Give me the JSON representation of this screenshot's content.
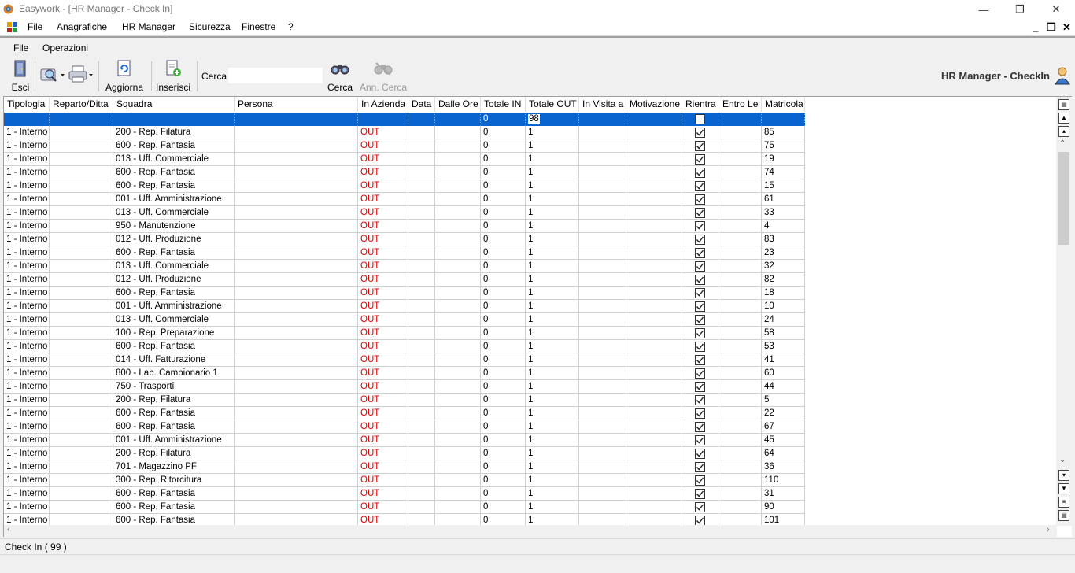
{
  "window": {
    "title": "Easywork - [HR Manager - Check In]"
  },
  "menubar": {
    "items": [
      "File",
      "Anagrafiche",
      "HR Manager",
      "Sicurezza",
      "Finestre",
      "?"
    ]
  },
  "childmenu": {
    "items": [
      "File",
      "Operazioni"
    ]
  },
  "toolbar": {
    "esci": "Esci",
    "aggiorna": "Aggiorna",
    "inserisci": "Inserisci",
    "cerca_label": "Cerca",
    "cerca_value": "",
    "cerca_button": "Cerca",
    "ann_cerca": "Ann. Cerca",
    "module_title": "HR Manager - CheckIn"
  },
  "grid": {
    "columns": [
      "Tipologia",
      "Reparto/Ditta",
      "Squadra",
      "Persona",
      "In Azienda",
      "Data",
      "Dalle Ore",
      "Totale IN",
      "Totale OUT",
      "In Visita a",
      "Motivazione",
      "Rientra",
      "Entro Le",
      "Matricola"
    ],
    "summary_row": {
      "totale_in": "0",
      "totale_out": "98",
      "rientra": false
    },
    "rows": [
      {
        "tipologia": "1 - Interno",
        "squadra": "200 - Rep. Filatura",
        "in_azienda": "OUT",
        "totale_in": "0",
        "totale_out": "1",
        "rientra": true,
        "matricola": "85"
      },
      {
        "tipologia": "1 - Interno",
        "squadra": "600 - Rep. Fantasia",
        "in_azienda": "OUT",
        "totale_in": "0",
        "totale_out": "1",
        "rientra": true,
        "matricola": "75"
      },
      {
        "tipologia": "1 - Interno",
        "squadra": "013 - Uff. Commerciale",
        "in_azienda": "OUT",
        "totale_in": "0",
        "totale_out": "1",
        "rientra": true,
        "matricola": "19"
      },
      {
        "tipologia": "1 - Interno",
        "squadra": "600 - Rep. Fantasia",
        "in_azienda": "OUT",
        "totale_in": "0",
        "totale_out": "1",
        "rientra": true,
        "matricola": "74"
      },
      {
        "tipologia": "1 - Interno",
        "squadra": "600 - Rep. Fantasia",
        "in_azienda": "OUT",
        "totale_in": "0",
        "totale_out": "1",
        "rientra": true,
        "matricola": "15"
      },
      {
        "tipologia": "1 - Interno",
        "squadra": "001 - Uff. Amministrazione",
        "in_azienda": "OUT",
        "totale_in": "0",
        "totale_out": "1",
        "rientra": true,
        "matricola": "61"
      },
      {
        "tipologia": "1 - Interno",
        "squadra": "013 - Uff. Commerciale",
        "in_azienda": "OUT",
        "totale_in": "0",
        "totale_out": "1",
        "rientra": true,
        "matricola": "33"
      },
      {
        "tipologia": "1 - Interno",
        "squadra": "950 - Manutenzione",
        "in_azienda": "OUT",
        "totale_in": "0",
        "totale_out": "1",
        "rientra": true,
        "matricola": "4"
      },
      {
        "tipologia": "1 - Interno",
        "squadra": "012 - Uff. Produzione",
        "in_azienda": "OUT",
        "totale_in": "0",
        "totale_out": "1",
        "rientra": true,
        "matricola": "83"
      },
      {
        "tipologia": "1 - Interno",
        "squadra": "600 - Rep. Fantasia",
        "in_azienda": "OUT",
        "totale_in": "0",
        "totale_out": "1",
        "rientra": true,
        "matricola": "23"
      },
      {
        "tipologia": "1 - Interno",
        "squadra": "013 - Uff. Commerciale",
        "in_azienda": "OUT",
        "totale_in": "0",
        "totale_out": "1",
        "rientra": true,
        "matricola": "32"
      },
      {
        "tipologia": "1 - Interno",
        "squadra": "012 - Uff. Produzione",
        "in_azienda": "OUT",
        "totale_in": "0",
        "totale_out": "1",
        "rientra": true,
        "matricola": "82"
      },
      {
        "tipologia": "1 - Interno",
        "squadra": "600 - Rep. Fantasia",
        "in_azienda": "OUT",
        "totale_in": "0",
        "totale_out": "1",
        "rientra": true,
        "matricola": "18"
      },
      {
        "tipologia": "1 - Interno",
        "squadra": "001 - Uff. Amministrazione",
        "in_azienda": "OUT",
        "totale_in": "0",
        "totale_out": "1",
        "rientra": true,
        "matricola": "10"
      },
      {
        "tipologia": "1 - Interno",
        "squadra": "013 - Uff. Commerciale",
        "in_azienda": "OUT",
        "totale_in": "0",
        "totale_out": "1",
        "rientra": true,
        "matricola": "24"
      },
      {
        "tipologia": "1 - Interno",
        "squadra": "100 - Rep. Preparazione",
        "in_azienda": "OUT",
        "totale_in": "0",
        "totale_out": "1",
        "rientra": true,
        "matricola": "58"
      },
      {
        "tipologia": "1 - Interno",
        "squadra": "600 - Rep. Fantasia",
        "in_azienda": "OUT",
        "totale_in": "0",
        "totale_out": "1",
        "rientra": true,
        "matricola": "53"
      },
      {
        "tipologia": "1 - Interno",
        "squadra": "014 - Uff. Fatturazione",
        "in_azienda": "OUT",
        "totale_in": "0",
        "totale_out": "1",
        "rientra": true,
        "matricola": "41"
      },
      {
        "tipologia": "1 - Interno",
        "squadra": "800 - Lab. Campionario 1",
        "in_azienda": "OUT",
        "totale_in": "0",
        "totale_out": "1",
        "rientra": true,
        "matricola": "60"
      },
      {
        "tipologia": "1 - Interno",
        "squadra": "750 - Trasporti",
        "in_azienda": "OUT",
        "totale_in": "0",
        "totale_out": "1",
        "rientra": true,
        "matricola": "44"
      },
      {
        "tipologia": "1 - Interno",
        "squadra": "200 - Rep. Filatura",
        "in_azienda": "OUT",
        "totale_in": "0",
        "totale_out": "1",
        "rientra": true,
        "matricola": "5"
      },
      {
        "tipologia": "1 - Interno",
        "squadra": "600 - Rep. Fantasia",
        "in_azienda": "OUT",
        "totale_in": "0",
        "totale_out": "1",
        "rientra": true,
        "matricola": "22"
      },
      {
        "tipologia": "1 - Interno",
        "squadra": "600 - Rep. Fantasia",
        "in_azienda": "OUT",
        "totale_in": "0",
        "totale_out": "1",
        "rientra": true,
        "matricola": "67"
      },
      {
        "tipologia": "1 - Interno",
        "squadra": "001 - Uff. Amministrazione",
        "in_azienda": "OUT",
        "totale_in": "0",
        "totale_out": "1",
        "rientra": true,
        "matricola": "45"
      },
      {
        "tipologia": "1 - Interno",
        "squadra": "200 - Rep. Filatura",
        "in_azienda": "OUT",
        "totale_in": "0",
        "totale_out": "1",
        "rientra": true,
        "matricola": "64"
      },
      {
        "tipologia": "1 - Interno",
        "squadra": "701 - Magazzino PF",
        "in_azienda": "OUT",
        "totale_in": "0",
        "totale_out": "1",
        "rientra": true,
        "matricola": "36"
      },
      {
        "tipologia": "1 - Interno",
        "squadra": "300 - Rep. Ritorcitura",
        "in_azienda": "OUT",
        "totale_in": "0",
        "totale_out": "1",
        "rientra": true,
        "matricola": "110"
      },
      {
        "tipologia": "1 - Interno",
        "squadra": "600 - Rep. Fantasia",
        "in_azienda": "OUT",
        "totale_in": "0",
        "totale_out": "1",
        "rientra": true,
        "matricola": "31"
      },
      {
        "tipologia": "1 - Interno",
        "squadra": "600 - Rep. Fantasia",
        "in_azienda": "OUT",
        "totale_in": "0",
        "totale_out": "1",
        "rientra": true,
        "matricola": "90"
      },
      {
        "tipologia": "1 - Interno",
        "squadra": "600 - Rep. Fantasia",
        "in_azienda": "OUT",
        "totale_in": "0",
        "totale_out": "1",
        "rientra": true,
        "matricola": "101"
      }
    ]
  },
  "statusbar": {
    "text": "Check In ( 99 )"
  },
  "colors": {
    "selection": "#0a64d0",
    "out_text": "#e00000"
  }
}
